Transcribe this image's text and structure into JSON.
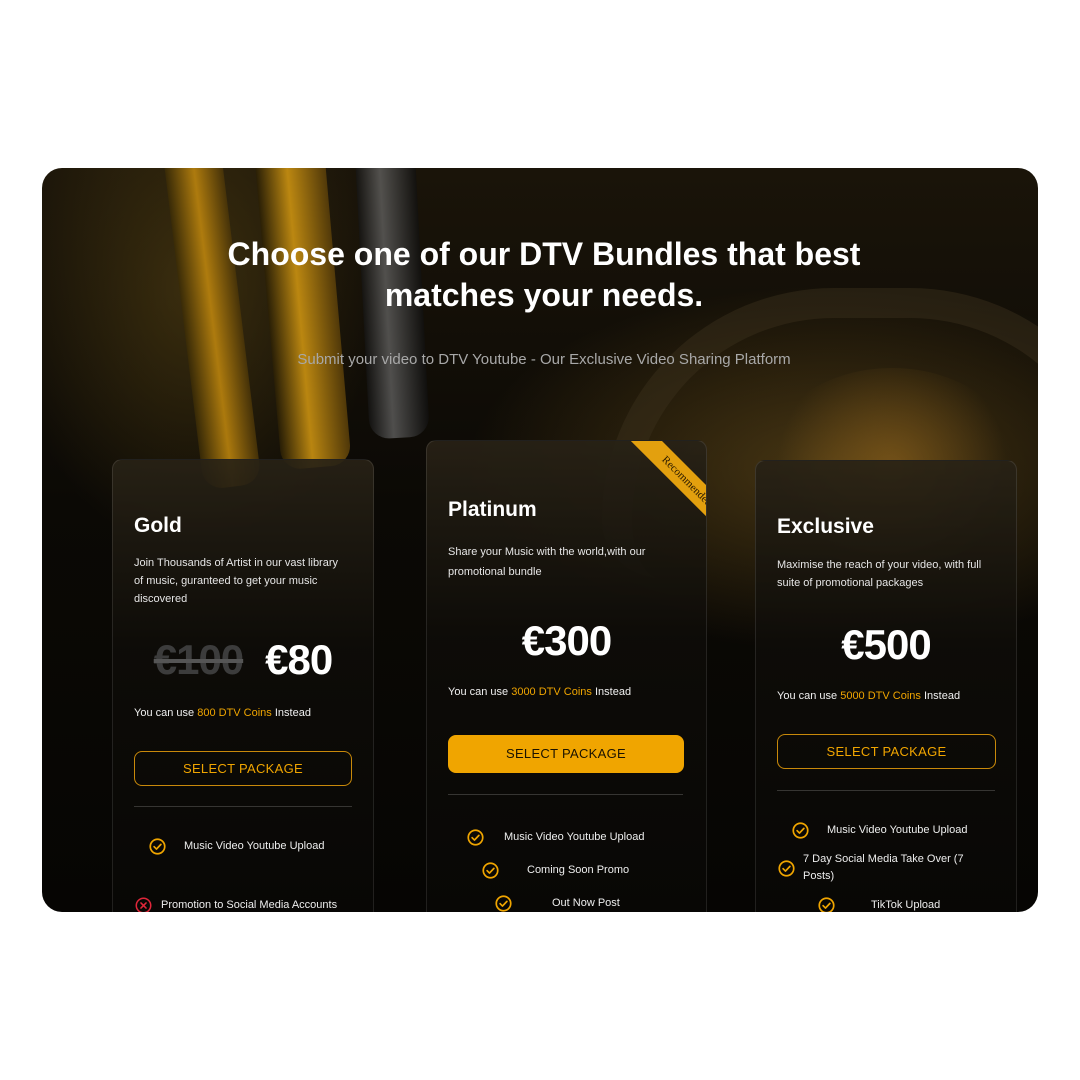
{
  "header": {
    "title_line1": "Choose one of our DTV Bundles that best",
    "title_line2": "matches your needs.",
    "subtitle": "Submit your video to DTV Youtube - Our Exclusive Video Sharing Platform"
  },
  "colors": {
    "accent": "#f0a500",
    "panel_bg": "#0b0905",
    "error": "#e0263a"
  },
  "plans": {
    "gold": {
      "name": "Gold",
      "description": "Join Thousands of Artist in our vast library of music, guranteed to get your music discovered",
      "old_price": "€100",
      "price": "€80",
      "coins_prefix": "You can use ",
      "coins_value": "800 DTV Coins",
      "coins_suffix": " Instead",
      "button": "SELECT PACKAGE",
      "features": [
        {
          "text": "Music Video Youtube Upload",
          "icon": "check-circle-icon"
        },
        {
          "text": "Promotion to Social Media Accounts",
          "icon": "cross-circle-icon"
        }
      ]
    },
    "platinum": {
      "name": "Platinum",
      "badge": "Recommended",
      "description": "Share your Music with the world,with our promotional bundle",
      "price": "€300",
      "coins_prefix": "You can use ",
      "coins_value": "3000 DTV Coins",
      "coins_suffix": " Instead",
      "button": "SELECT PACKAGE",
      "features": [
        {
          "text": "Music Video Youtube Upload",
          "icon": "check-circle-icon"
        },
        {
          "text": "Coming Soon Promo",
          "icon": "check-circle-icon"
        },
        {
          "text": "Out Now Post",
          "icon": "check-circle-icon"
        }
      ]
    },
    "exclusive": {
      "name": "Exclusive",
      "description": "Maximise the reach of your video, with full suite of promotional packages",
      "price": "€500",
      "coins_prefix": "You can use ",
      "coins_value": "5000 DTV Coins",
      "coins_suffix": " Instead",
      "button": "SELECT PACKAGE",
      "features": [
        {
          "text": "Music Video Youtube Upload",
          "icon": "check-circle-icon"
        },
        {
          "text": "7 Day Social Media Take Over (7 Posts)",
          "icon": "check-circle-icon"
        },
        {
          "text": "TikTok Upload",
          "icon": "check-circle-icon"
        }
      ]
    }
  }
}
